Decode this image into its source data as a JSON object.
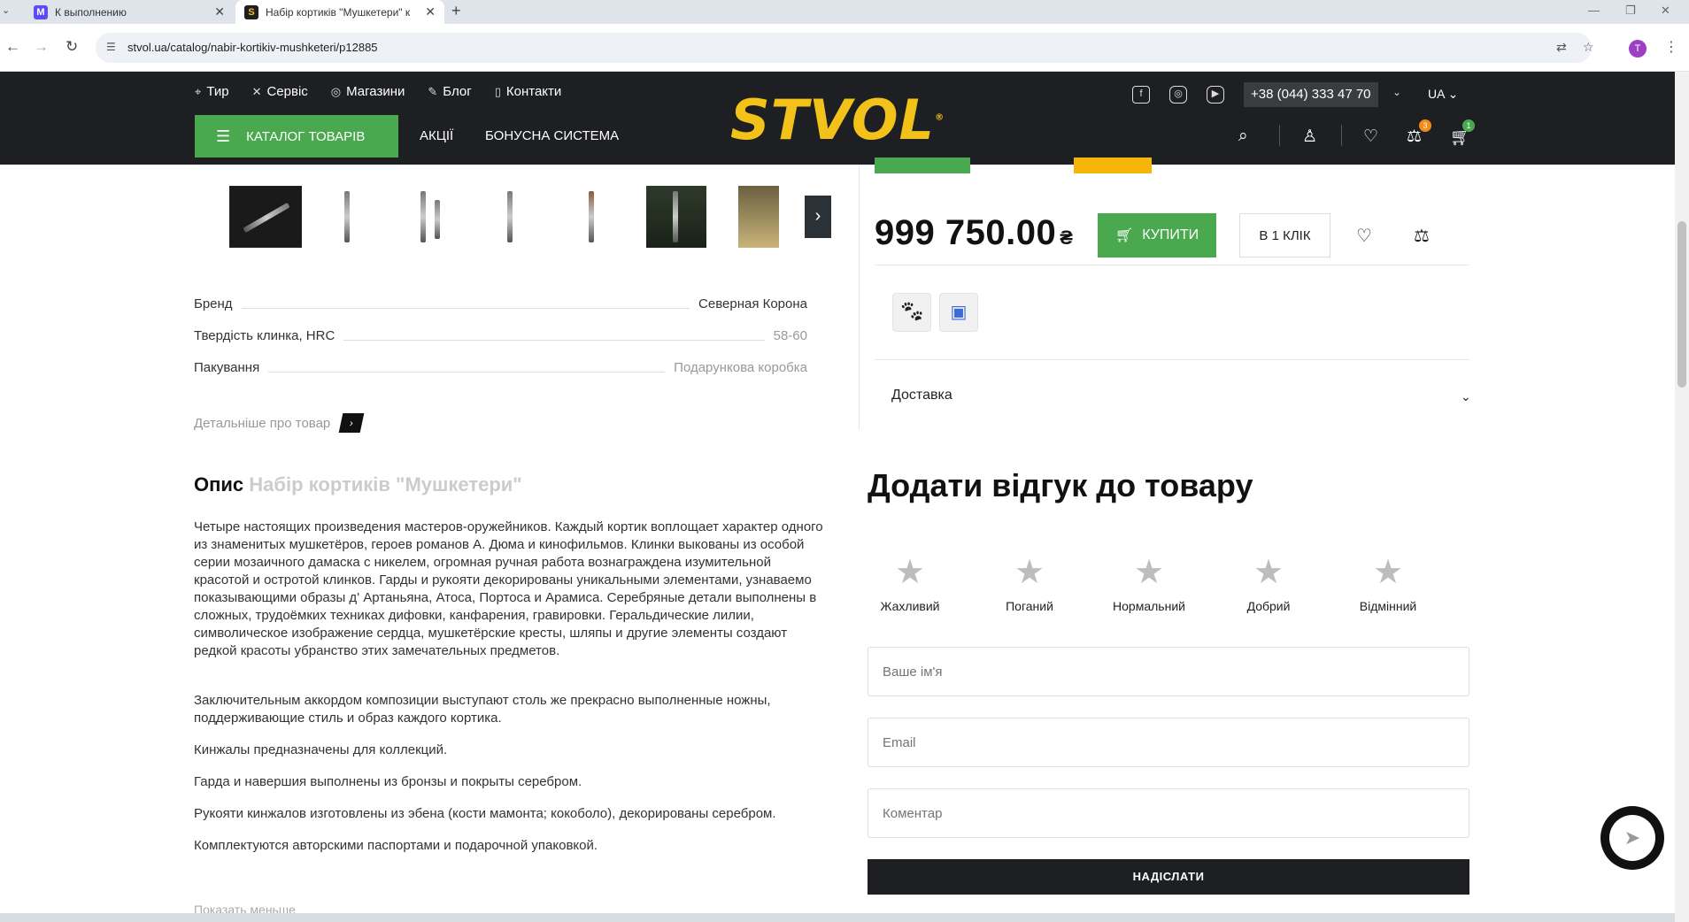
{
  "browser": {
    "tabs": [
      {
        "title": "К выполнению",
        "favicon": "M"
      },
      {
        "title": "Набір кортиків \"Мушкетери\" к",
        "favicon": "S"
      }
    ],
    "url": "stvol.ua/catalog/nabir-kortikiv-mushketeri/p12885",
    "profile_initial": "T"
  },
  "header": {
    "topnav": [
      {
        "label": "Тир",
        "icon": "target-icon"
      },
      {
        "label": "Сервіс",
        "icon": "tools-icon"
      },
      {
        "label": "Магазини",
        "icon": "pin-icon"
      },
      {
        "label": "Блог",
        "icon": "pen-icon"
      },
      {
        "label": "Контакти",
        "icon": "phone-icon"
      }
    ],
    "catalog_label": "КАТАЛОГ ТОВАРІВ",
    "promo_label": "АКЦІЇ",
    "bonus_label": "БОНУСНА СИСТЕМА",
    "logo": "STVOL",
    "phone": "+38 (044) 333 47 70",
    "lang": "UA",
    "compare_count": "3",
    "cart_count": "1"
  },
  "product": {
    "attributes": [
      {
        "label": "Бренд",
        "value": "Северная Корона"
      },
      {
        "label": "Твердість клинка, HRC",
        "value": "58-60"
      },
      {
        "label": "Пакування",
        "value": "Подарункова коробка"
      }
    ],
    "more_link": "Детальніше про товар",
    "price": "999 750.00",
    "currency": "₴",
    "buy_label": "КУПИТИ",
    "oneclick_label": "В 1 КЛІК",
    "delivery_label": "Доставка"
  },
  "description": {
    "title": "Опис",
    "subtitle": "Набір кортиків \"Мушкетери\"",
    "paragraphs": [
      "Четыре настоящих произведения мастеров-оружейников. Каждый кортик воплощает характер одного из знаменитых мушкетёров, героев романов А. Дюма и кинофильмов. Клинки выкованы из особой серии мозаичного дамаска с никелем, огромная ручная работа вознаграждена изумительной красотой и остротой клинков. Гарды и рукояти декорированы уникальными элементами, узнаваемо показывающими образы д' Артаньяна, Атоса, Портоса и Арамиса. Серебряные детали выполнены в сложных, трудоёмких техниках дифовки, канфарения, гравировки. Геральдические лилии, символическое изображение сердца, мушкетёрские кресты, шляпы и другие элементы создают редкой красоты убранство этих замечательных предметов.",
      "Заключительным аккордом композиции выступают столь же прекрасно выполненные ножны, поддерживающие стиль и образ каждого кортика.",
      "Кинжалы предназначены для коллекций.",
      "Гарда и навершия выполнены из бронзы и покрыты серебром.",
      "Рукояти кинжалов изготовлены из эбена (кости мамонта; кокоболо), декорированы серебром.",
      "Комплектуются авторскими паспортами и подарочной упаковкой."
    ],
    "less_link": "Показать меньше"
  },
  "review": {
    "title": "Додати відгук до товару",
    "ratings": [
      "Жахливий",
      "Поганий",
      "Нормальний",
      "Добрий",
      "Відмінний"
    ],
    "name_placeholder": "Ваше ім'я",
    "email_placeholder": "Email",
    "comment_placeholder": "Коментар",
    "submit_label": "НАДІСЛАТИ"
  },
  "colors": {
    "accent_green": "#4aa94e",
    "logo_yellow": "#f2c21a",
    "header_dark": "#1d1f22"
  }
}
